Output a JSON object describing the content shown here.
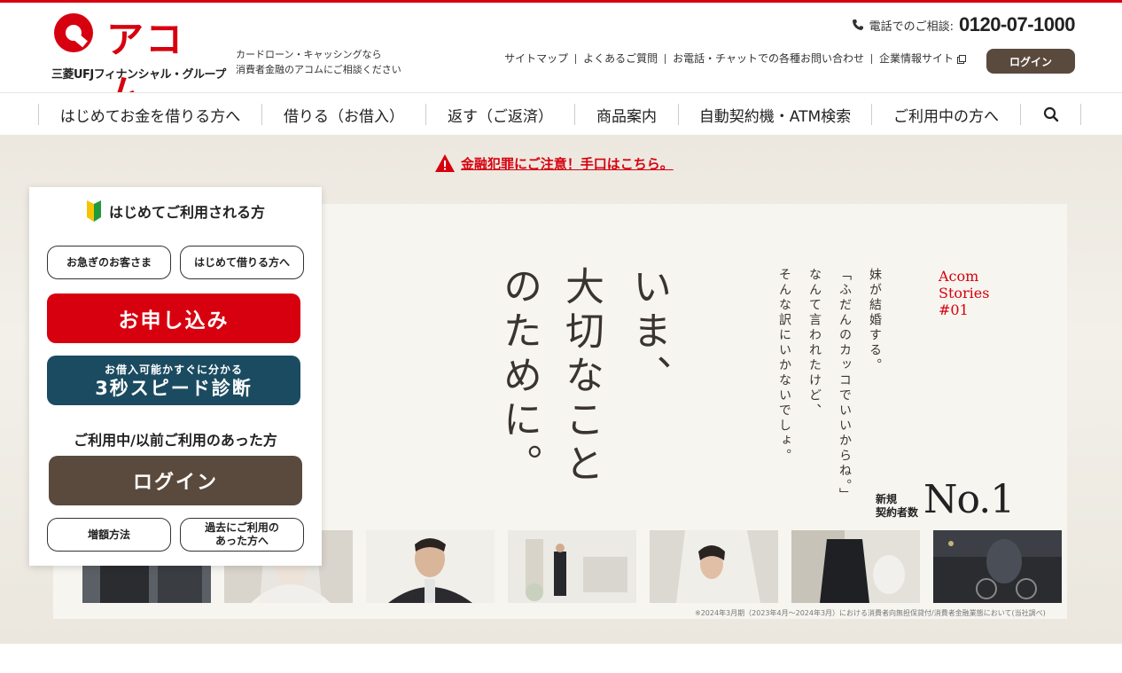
{
  "brand": {
    "logo_text": "アコム",
    "group_name": "三菱UFJフィナンシャル・グループ",
    "tagline_line1": "カードローン・キャッシングなら",
    "tagline_line2": "消費者金融のアコムにご相談ください",
    "brand_color": "#d7000f"
  },
  "header": {
    "phone_label": "電話でのご相談:",
    "phone_number": "0120-07-1000",
    "util_links": [
      "サイトマップ",
      "よくあるご質問",
      "お電話・チャットでの各種お問い合わせ",
      "企業情報サイト"
    ],
    "login_label": "ログイン"
  },
  "nav": {
    "items": [
      "はじめてお金を借りる方へ",
      "借りる（お借入）",
      "返す（ご返済）",
      "商品案内",
      "自動契約機・ATM検索",
      "ご利用中の方へ"
    ],
    "search_icon": "search-icon"
  },
  "alert": {
    "text": "金融犯罪にご注意！手口はこちら。"
  },
  "poster": {
    "headline_col1": "いま、",
    "headline_col2": "大切なこと",
    "headline_col3": "のために。",
    "copy_col1": "妹が結婚する。",
    "copy_col2": "「ふだんのカッコでいいからね。」",
    "copy_col3": "なんて言われたけど、",
    "copy_col4": "そんな訳にいかないでしょ。",
    "stories_line1": "Acom",
    "stories_line2": "Stories",
    "stories_line3": "#01",
    "no1_label_line1": "新規",
    "no1_label_line2": "契約者数",
    "no1_value": "No.1",
    "footnote": "※2024年3月期（2023年4月〜2024年3月）における消費者向無担保貸付/消費者金融業態において(当社調べ)"
  },
  "panel": {
    "title": "はじめてご利用される方",
    "urgent_label": "お急ぎのお客さま",
    "first_borrow_label": "はじめて借りる方へ",
    "apply_label": "お申し込み",
    "diagnosis_sub": "お借入可能かすぐに分かる",
    "diagnosis_main": "3秒スピード診断",
    "returning_title": "ご利用中/以前ご利用のあった方",
    "login_label": "ログイン",
    "increase_label": "増額方法",
    "past_user_line1": "過去にご利用の",
    "past_user_line2": "あった方へ"
  }
}
